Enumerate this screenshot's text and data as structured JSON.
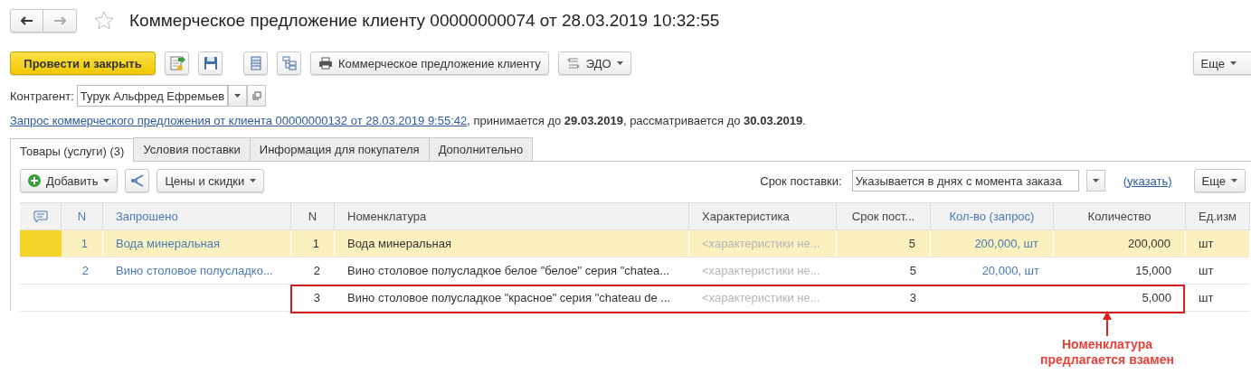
{
  "window": {
    "title": "Коммерческое предложение клиенту 00000000074 от 28.03.2019 10:32:55",
    "favorite": false
  },
  "toolbar": {
    "post_button": "Провести и закрыть",
    "print_button": "Коммерческое предложение клиенту",
    "edo_button": "ЭДО",
    "more_button": "Еще"
  },
  "counterparty": {
    "label": "Контрагент:",
    "value": "Турук Альфред Ефремьев"
  },
  "basis": {
    "link": "Запрос коммерческого предложения от клиента 00000000132 от 28.03.2019 9:55:42",
    "text": ", принимается до **29.03.2019**, рассматривается до **30.03.2019**."
  },
  "tabs": [
    {
      "label": "Товары (услуги) (3)",
      "selected": true
    },
    {
      "label": "Условия поставки",
      "selected": false
    },
    {
      "label": "Информация для покупателя",
      "selected": false
    },
    {
      "label": "Дополнительно",
      "selected": false
    }
  ],
  "table_toolbar": {
    "add_button": "Добавить",
    "prices_button": "Цены и скидки",
    "delivery_label": "Срок поставки:",
    "delivery_value": "Указывается в днях с момента заказа",
    "specify_link": "(указать)",
    "more_button": "Еще"
  },
  "table": {
    "columns": [
      {
        "label": "N",
        "kind": "link-number"
      },
      {
        "label": "Запрошено",
        "kind": "link"
      },
      {
        "label": "N",
        "kind": "number"
      },
      {
        "label": "Номенклатура",
        "kind": "text"
      },
      {
        "label": "Характеристика",
        "kind": "hint"
      },
      {
        "label": "Срок пост...",
        "kind": "number"
      },
      {
        "label": "Кол-во (запрос)",
        "kind": "link-number"
      },
      {
        "label": "Количество",
        "kind": "number"
      },
      {
        "label": "Ед.изм",
        "kind": "text"
      }
    ],
    "rows": [
      {
        "selected": true,
        "flagged": false,
        "cells": [
          "1",
          "Вода минеральная",
          "1",
          "Вода минеральная",
          "<характеристики не...",
          "5",
          "200,000, шт",
          "200,000",
          "шт"
        ]
      },
      {
        "selected": false,
        "flagged": false,
        "cells": [
          "2",
          "Вино столовое полусладко...",
          "2",
          "Вино столовое полусладкое белое \"белое\" серия \"chatea...",
          "<характеристики не...",
          "5",
          "20,000, шт",
          "15,000",
          "шт"
        ]
      },
      {
        "selected": false,
        "flagged": true,
        "cells": [
          null,
          null,
          "3",
          "Вино столовое полусладкое \"красное\" серия \"chateau de ...",
          "<характеристики не...",
          "3",
          null,
          "5,000",
          "шт"
        ]
      }
    ]
  },
  "annotation": {
    "text": "Номенклатура предлагается взамен"
  }
}
